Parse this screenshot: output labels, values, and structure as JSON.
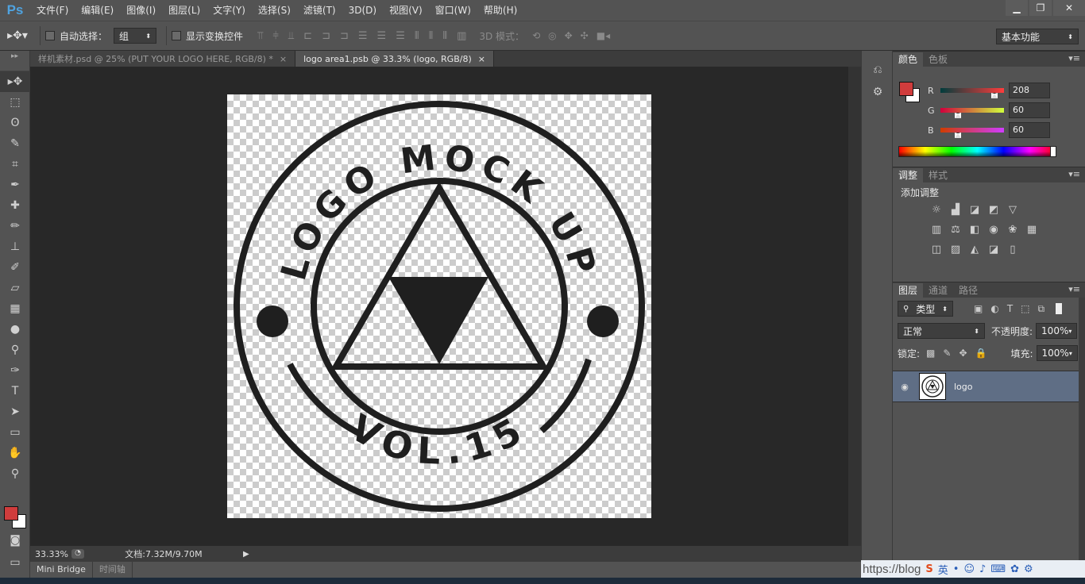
{
  "app": {
    "logo": "Ps"
  },
  "menu": [
    "文件(F)",
    "编辑(E)",
    "图像(I)",
    "图层(L)",
    "文字(Y)",
    "选择(S)",
    "滤镜(T)",
    "3D(D)",
    "视图(V)",
    "窗口(W)",
    "帮助(H)"
  ],
  "window_controls": {
    "minimize": "▁",
    "restore": "❐",
    "close": "✕"
  },
  "options": {
    "auto_select_label": "自动选择：",
    "auto_select_value": "组",
    "show_transform_label": "显示变换控件",
    "mode3d_label": "3D 模式：",
    "workspace": "基本功能"
  },
  "doc_tabs": [
    {
      "title": "样机素材.psd @ 25% (PUT YOUR LOGO HERE, RGB/8) *",
      "active": false
    },
    {
      "title": "logo area1.psb @ 33.3% (logo, RGB/8)",
      "active": true
    }
  ],
  "tab_close": "×",
  "artwork": {
    "top_text": "LOGO MOCK UP",
    "bottom_text": "VOL.15"
  },
  "status": {
    "zoom": "33.33%",
    "doc": "文档:7.32M/9.70M"
  },
  "bottom_tabs": [
    "Mini Bridge",
    "时间轴"
  ],
  "color_panel": {
    "tabs": [
      "颜色",
      "色板"
    ],
    "fg_color": "#d03c3c",
    "channels": [
      {
        "label": "R",
        "value": "208",
        "level": 0.816
      },
      {
        "label": "G",
        "value": "60",
        "level": 0.235
      },
      {
        "label": "B",
        "value": "60",
        "level": 0.235
      }
    ]
  },
  "adjust_panel": {
    "tabs": [
      "调整",
      "样式"
    ],
    "title": "添加调整"
  },
  "layers_panel": {
    "tabs": [
      "图层",
      "通道",
      "路径"
    ],
    "filter_kind": "类型",
    "blend_mode": "正常",
    "opacity_label": "不透明度:",
    "opacity_value": "100%",
    "lock_label": "锁定:",
    "fill_label": "填充:",
    "fill_value": "100%",
    "layers": [
      {
        "name": "logo",
        "visible_icon": "👁"
      }
    ]
  },
  "tray": {
    "url": "https://blog"
  }
}
